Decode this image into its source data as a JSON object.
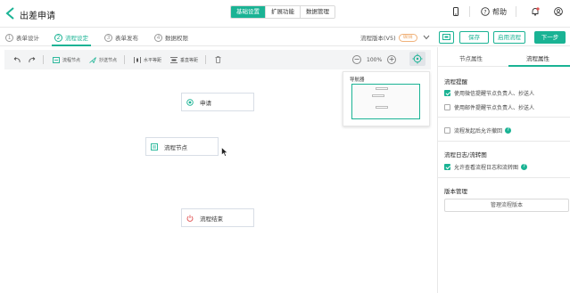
{
  "header": {
    "title": "出差申请",
    "tabs": [
      {
        "label": "基础设置",
        "active": true
      },
      {
        "label": "扩展功能",
        "active": false
      },
      {
        "label": "数据管理",
        "active": false
      }
    ],
    "help_label": "帮助",
    "icons": [
      "mobile-icon",
      "help-icon",
      "bell-icon",
      "user-icon"
    ]
  },
  "steps": [
    {
      "num": "1",
      "label": "表单设计"
    },
    {
      "num": "2",
      "label": "流程设定"
    },
    {
      "num": "3",
      "label": "表单发布"
    },
    {
      "num": "4",
      "label": "数据权限"
    }
  ],
  "active_step": 2,
  "version": {
    "label": "流程版本(V5)",
    "badge": "编辑"
  },
  "actions": {
    "save": "保存",
    "enable": "启用流程",
    "next": "下一步"
  },
  "toolbar": {
    "flow_node": "流程节点",
    "cc_node": "抄送节点",
    "h_space": "水平等距",
    "v_space": "垂直等距",
    "zoom": "100%"
  },
  "navigator": {
    "title": "导航器"
  },
  "nodes": [
    {
      "label": "申请",
      "kind": "start"
    },
    {
      "label": "流程节点",
      "kind": "process"
    },
    {
      "label": "流程结束",
      "kind": "end"
    }
  ],
  "panel": {
    "tabs": [
      "节点属性",
      "流程属性"
    ],
    "active_tab": 1,
    "reminder": {
      "title": "流程提醒",
      "items": [
        {
          "label": "使用微信提醒节点负责人、抄送人",
          "checked": true
        },
        {
          "label": "使用邮件提醒节点负责人、抄送人",
          "checked": false
        }
      ]
    },
    "withdraw": {
      "label": "流程发起后允许撤回",
      "checked": false
    },
    "log": {
      "title": "流程日志/流转图",
      "items": [
        {
          "label": "允许查看流程日志和流转图",
          "checked": true
        }
      ]
    },
    "version_mgmt": {
      "title": "版本管理",
      "button": "管理流程版本"
    }
  },
  "colors": {
    "accent": "#1ab394",
    "badge": "#f0b27a",
    "end_icon": "#e05252",
    "node_border": "#d8dee6"
  }
}
